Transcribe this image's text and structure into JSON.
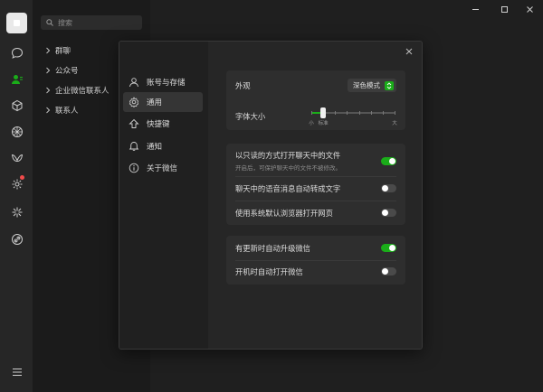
{
  "contacts": {
    "search_placeholder": "搜索",
    "groups": [
      {
        "label": "群聊"
      },
      {
        "label": "公众号"
      },
      {
        "label": "企业微信联系人"
      },
      {
        "label": "联系人"
      }
    ]
  },
  "settings": {
    "nav": [
      {
        "label": "账号与存储",
        "icon": "user-icon"
      },
      {
        "label": "通用",
        "icon": "gear-icon",
        "active": true
      },
      {
        "label": "快捷键",
        "icon": "shortcut-icon"
      },
      {
        "label": "通知",
        "icon": "bell-icon"
      },
      {
        "label": "关于微信",
        "icon": "info-icon"
      }
    ],
    "appearance": {
      "label": "外观",
      "value": "深色模式"
    },
    "font_size": {
      "label": "字体大小",
      "min_label": "小",
      "mid_label": "标准",
      "max_label": "大",
      "steps": 8,
      "current_step": 1
    },
    "readonly_files": {
      "label": "以只读的方式打开聊天中的文件",
      "sub": "开启后，可保护聊天中的文件不被修改。",
      "enabled": true
    },
    "voice_to_text": {
      "label": "聊天中的语音消息自动转成文字",
      "enabled": false
    },
    "default_browser": {
      "label": "使用系统默认浏览器打开网页",
      "enabled": false
    },
    "auto_update": {
      "label": "有更新时自动升级微信",
      "enabled": true
    },
    "auto_start": {
      "label": "开机时自动打开微信",
      "enabled": false
    }
  },
  "colors": {
    "accent": "#1aad19",
    "notification": "#f24b4b"
  }
}
